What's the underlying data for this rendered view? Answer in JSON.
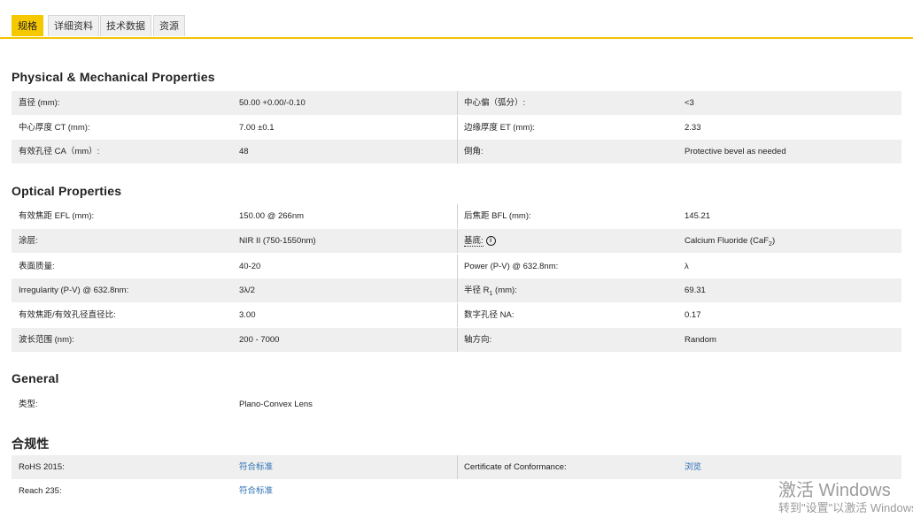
{
  "tabs": [
    {
      "label": "规格",
      "active": true
    },
    {
      "label": "详细资料"
    },
    {
      "label": "技术数据"
    },
    {
      "label": "资源"
    }
  ],
  "sections": {
    "physical": {
      "title": "Physical & Mechanical Properties",
      "rows": [
        [
          "直径 (mm):",
          "50.00 +0.00/-0.10",
          "中心偏（弧分）:",
          "<3"
        ],
        [
          "中心厚度 CT (mm):",
          "7.00 ±0.1",
          "边缘厚度 ET (mm):",
          "2.33"
        ],
        [
          "有效孔径 CA（mm）:",
          "48",
          "倒角:",
          "Protective bevel as needed"
        ]
      ]
    },
    "optical": {
      "title": "Optical Properties",
      "rows": [
        [
          "有效焦距 EFL (mm):",
          "150.00 @ 266nm",
          "后焦距 BFL (mm):",
          "145.21"
        ],
        [
          "涂层:",
          "NIR II (750-1550nm)",
          "基底:",
          "Calcium Fluoride (CaF",
          "2",
          ")"
        ],
        [
          "表面质量:",
          "40-20",
          "Power (P-V) @ 632.8nm:",
          "λ"
        ],
        [
          "Irregularity (P-V) @ 632.8nm:",
          "3λ/2",
          "半径 R",
          "1",
          " (mm):",
          "69.31"
        ],
        [
          "有效焦距/有效孔径直径比:",
          "3.00",
          "数字孔径 NA:",
          "0.17"
        ],
        [
          "波长范围 (nm):",
          "200 - 7000",
          "轴方向:",
          "Random"
        ]
      ]
    },
    "general": {
      "title": "General",
      "rows": [
        [
          "类型:",
          "Plano-Convex Lens"
        ]
      ]
    },
    "compliance": {
      "title": "合规性",
      "rows": [
        [
          "RoHS 2015:",
          "符合标准",
          "Certificate of Conformance:",
          "浏览"
        ],
        [
          "Reach 235:",
          "符合标准"
        ]
      ]
    }
  },
  "watermark": {
    "line1": "激活 Windows",
    "line2": "转到\"设置\"以激活 Windows"
  }
}
